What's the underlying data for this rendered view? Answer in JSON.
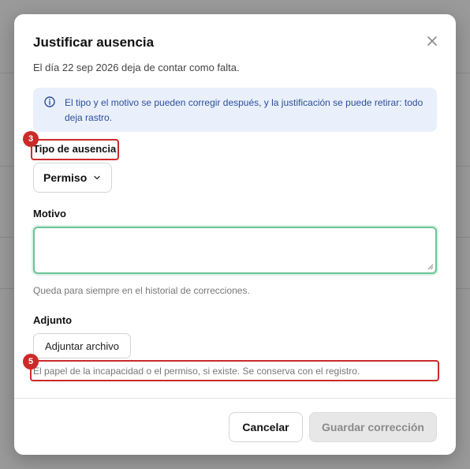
{
  "dialog": {
    "title": "Justificar ausencia",
    "subtitle": "El día 22 sep 2026 deja de contar como falta.",
    "info": "El tipo y el motivo se pueden corregir después, y la justificación se puede retirar: todo deja rastro.",
    "absence_type": {
      "label": "Tipo de ausencia",
      "selected": "Permiso"
    },
    "motivo": {
      "label": "Motivo",
      "value": "",
      "help": "Queda para siempre en el historial de correcciones."
    },
    "attachment": {
      "label": "Adjunto",
      "button": "Adjuntar archivo",
      "help": "El papel de la incapacidad o el permiso, si existe. Se conserva con el registro."
    },
    "footer": {
      "cancel": "Cancelar",
      "save": "Guardar corrección"
    }
  },
  "markers": {
    "absence_type": "3",
    "attachment_help": "5"
  },
  "colors": {
    "info_bg": "#eaf0fb",
    "info_text": "#2a4e9c",
    "focus_border": "#6cc49a",
    "marker": "#cc2a2a"
  },
  "icons": {
    "close": "close-icon",
    "info": "info-icon",
    "select": "chevron-down-icon"
  }
}
